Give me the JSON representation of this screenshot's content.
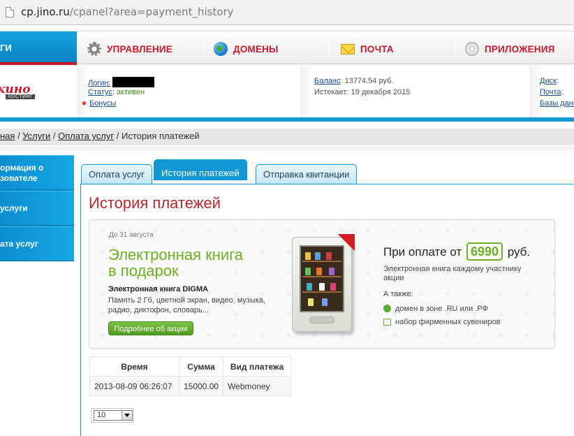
{
  "browser": {
    "url_host": "cp.jino.ru",
    "url_path": "/cpanel?area=payment_history"
  },
  "topnav": {
    "active_label": "ГИ",
    "items": [
      {
        "label": "УПРАВЛЕНИЕ",
        "icon": "gear-icon"
      },
      {
        "label": "ДОМЕНЫ",
        "icon": "globe-icon"
      },
      {
        "label": "ПОЧТА",
        "icon": "mail-icon"
      },
      {
        "label": "ПРИЛОЖЕНИЯ",
        "icon": "disc-icon"
      }
    ]
  },
  "logo": {
    "brand": "кино",
    "sub": "ХОСТИНГ"
  },
  "account": {
    "login_label": "Логин:",
    "status_label": "Статус",
    "status_value": "активен",
    "bonus_label": "Бонусы",
    "balance_label": "Баланс",
    "balance_value": "13774.54 руб.",
    "expires_label": "Истекает:",
    "expires_value": "19 декабря 2015",
    "disk_label": "Диск",
    "mail_label": "Почта",
    "db_label": "Базы данн"
  },
  "breadcrumb": {
    "items": [
      "ная",
      "Услуги",
      "Оплата услуг"
    ],
    "current": "История платежей"
  },
  "sidebar": {
    "items": [
      {
        "line1": "ормация о",
        "line2": "зователе"
      },
      {
        "line1": "услуги",
        "line2": ""
      },
      {
        "line1": "ата услуг",
        "line2": ""
      }
    ]
  },
  "tabs": [
    {
      "label": "Оплата услуг",
      "selected": false
    },
    {
      "label": "История платежей",
      "selected": true
    },
    {
      "label": "Отправка квитанции",
      "selected": false
    }
  ],
  "page_title": "История платежей",
  "promo": {
    "date": "До 31 августа",
    "headline_1": "Электронная книга",
    "headline_2": "в подарок",
    "product_name": "Электронная книга DIGMA",
    "product_desc": "Память 2 Гб, цветной экран, видео, музыка, радио, диктофон, словарь...",
    "more_button": "Подробнее об акции",
    "price_prefix": "При оплате от",
    "price_value": "6990",
    "price_suffix": "руб.",
    "gift_text": "Электронная книга каждому участнику акции",
    "also_label": "А также:",
    "options": [
      "домен в зоне .RU или .РФ",
      "набор фирменных сувениров"
    ],
    "accent_color": "#6cb123"
  },
  "payments": {
    "columns": [
      "Время",
      "Сумма",
      "Вид платежа"
    ],
    "rows": [
      [
        "2013-08-09 06:26:07",
        "15000.00",
        "Webmoney"
      ]
    ]
  },
  "page_size": {
    "value": "10"
  },
  "colors": {
    "brand_red": "#c9182b",
    "brand_blue": "#1198d4"
  }
}
